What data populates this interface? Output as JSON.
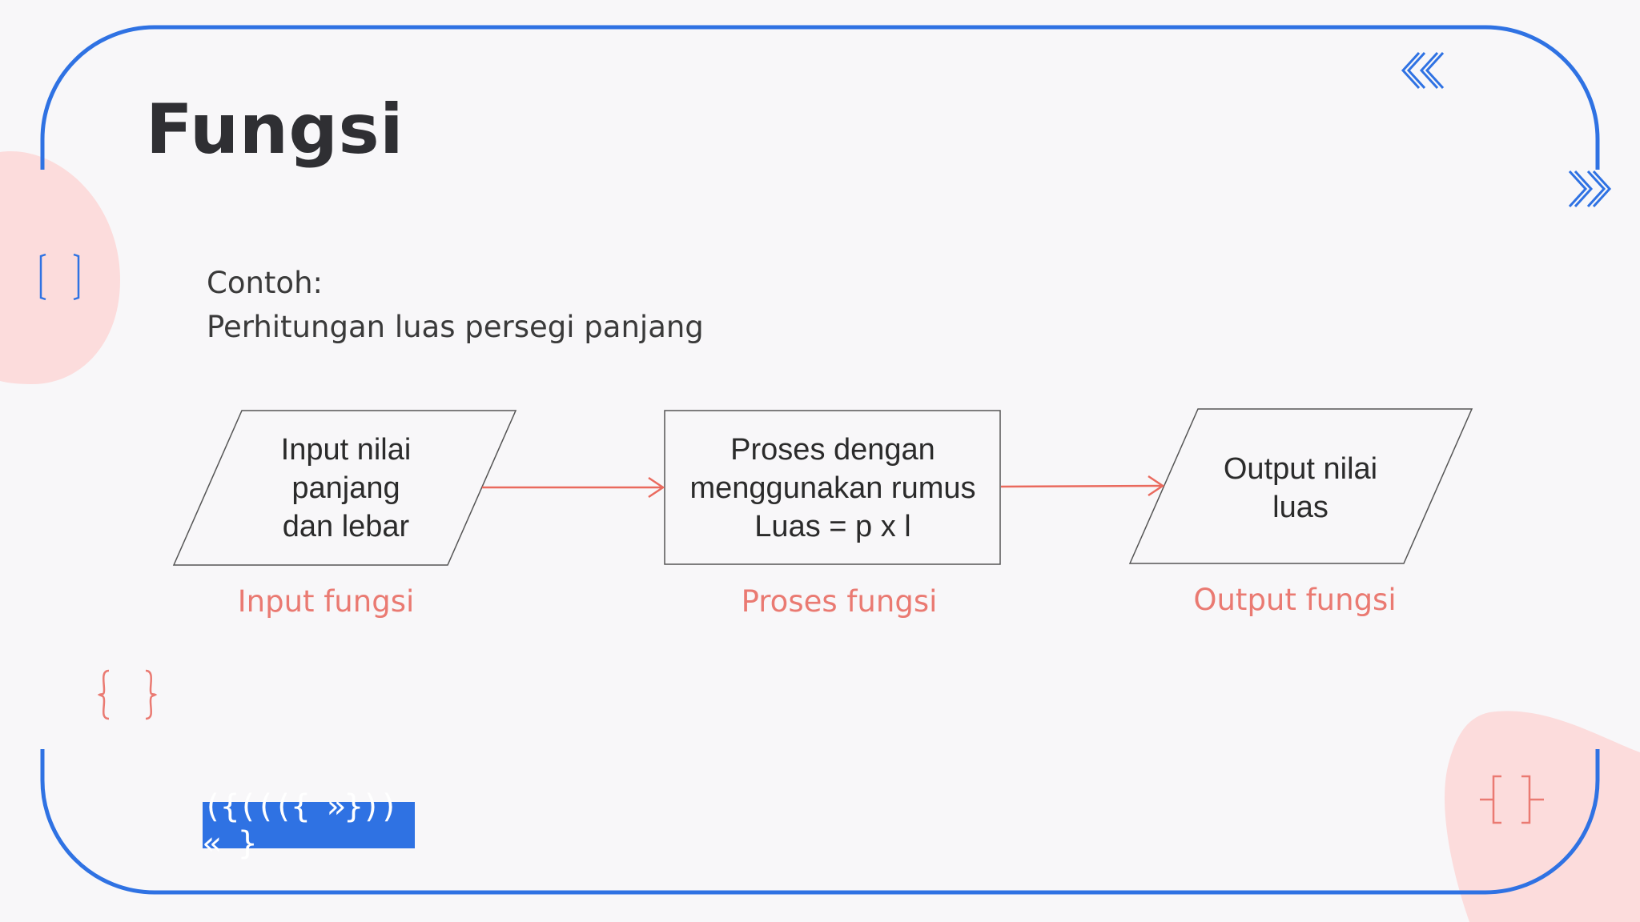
{
  "title": "Fungsi",
  "intro": {
    "line1": "Contoh:",
    "line2": "Perhitungan luas persegi panjang"
  },
  "flow": {
    "input": {
      "lines": [
        "Input nilai",
        "panjang",
        "dan lebar"
      ],
      "caption": "Input fungsi"
    },
    "process": {
      "lines": [
        "Proses dengan",
        "menggunakan rumus",
        "Luas = p x l"
      ],
      "caption": "Proses fungsi"
    },
    "output": {
      "lines": [
        "Output nilai",
        "luas"
      ],
      "caption": "Output fungsi"
    }
  },
  "code_banner": "({((({ »})) « }",
  "colors": {
    "accent_blue": "#2f72e3",
    "accent_pink": "#ea7a72",
    "blob_pink": "#fcdcdc",
    "text_dark": "#2f2f33",
    "background": "#f8f7f9"
  }
}
